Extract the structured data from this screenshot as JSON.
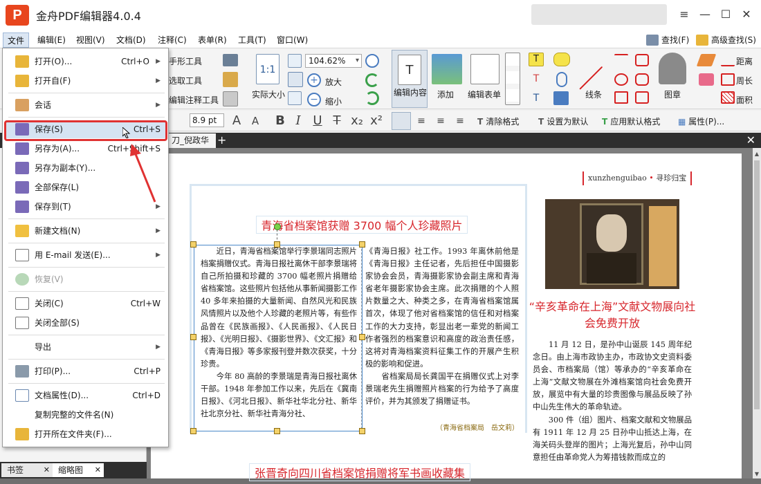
{
  "app": {
    "title": "金舟PDF编辑器4.0.4",
    "logo_letter": "P",
    "accent": "#e8461e"
  },
  "window_controls": {
    "menu": "≡",
    "minimize": "—",
    "maximize": "☐",
    "close": "✕"
  },
  "menubar": {
    "items": [
      "文件",
      "编辑(E)",
      "视图(V)",
      "文档(D)",
      "注释(C)",
      "表单(R)",
      "工具(T)",
      "窗口(W)"
    ],
    "find": "查找(F)",
    "advanced_find": "高级查找(S)"
  },
  "ribbon": {
    "tools": [
      "手形工具",
      "选取工具",
      "编辑注释工具"
    ],
    "actual_size": "实际大小",
    "zoom": "104.62%",
    "zoom_in": "放大",
    "zoom_out": "缩小",
    "edit_content": "编辑内容",
    "add": "添加",
    "edit_form": "编辑表单",
    "line": "线条",
    "stamp": "图章",
    "distance": "距离",
    "perimeter": "周长",
    "area": "面积"
  },
  "formatbar": {
    "font_size": "8.9 pt",
    "clear_format": "清除格式",
    "set_default": "设置为默认",
    "apply_default": "应用默认格式",
    "properties": "属性(P)..."
  },
  "tabs": {
    "doc_tab": "刀_倪政华",
    "plus": "+",
    "close": "✕"
  },
  "left_panel": {
    "tabs": [
      "书签",
      "缩略图"
    ]
  },
  "file_menu": {
    "items": [
      {
        "label": "打开(O)...",
        "shortcut": "Ctrl+O",
        "submenu": true
      },
      {
        "label": "打开自(F)",
        "shortcut": "",
        "submenu": true
      },
      {
        "label": "会话",
        "shortcut": "",
        "submenu": true
      },
      {
        "label": "保存(S)",
        "shortcut": "Ctrl+S",
        "submenu": false,
        "highlighted": true
      },
      {
        "label": "另存为(A)...",
        "shortcut": "Ctrl+Shift+S",
        "submenu": false
      },
      {
        "label": "另存为副本(Y)...",
        "shortcut": "",
        "submenu": false
      },
      {
        "label": "全部保存(L)",
        "shortcut": "",
        "submenu": false
      },
      {
        "label": "保存到(T)",
        "shortcut": "",
        "submenu": true
      },
      {
        "label": "新建文档(N)",
        "shortcut": "",
        "submenu": true
      },
      {
        "label": "用 E-mail 发送(E)...",
        "shortcut": "",
        "submenu": true
      },
      {
        "label": "恢复(V)",
        "shortcut": "",
        "submenu": false,
        "disabled": true
      },
      {
        "label": "关闭(C)",
        "shortcut": "Ctrl+W",
        "submenu": false
      },
      {
        "label": "关闭全部(S)",
        "shortcut": "",
        "submenu": false
      },
      {
        "label": "导出",
        "shortcut": "",
        "submenu": true
      },
      {
        "label": "打印(P)...",
        "shortcut": "Ctrl+P",
        "submenu": false
      },
      {
        "label": "文档属性(D)...",
        "shortcut": "Ctrl+D",
        "submenu": false
      },
      {
        "label": "复制完整的文件名(N)",
        "shortcut": "",
        "submenu": false
      },
      {
        "label": "打开所在文件夹(F)...",
        "shortcut": "",
        "submenu": false
      }
    ]
  },
  "document": {
    "tag_text": "xunzhenguibao",
    "tag_dot": "•",
    "tag_cn": "寻珍归宝",
    "headline1": "青海省档案馆获赠 3700 幅个人珍藏照片",
    "col1": "　　近日，青海省档案馆举行李景瑞同志照片档案捐赠仪式。青海日报社离休干部李景瑞将自己所拍摄和珍藏的 3700 幅老照片捐赠给省档案馆。这些照片包括他从事新闻摄影工作 40 多年来拍摄的大量新闻、自然风光和民族风情照片以及他个人珍藏的老照片等，有些作品曾在《民族画报》、《人民画报》、《人民日报》、《光明日报》、《摄影世界》、《文汇报》和《青海日报》等多家报刊登并数次获奖，十分珍贵。\n　　今年 80 高龄的李景瑞是青海日报社离休干部。1948 年参加工作以来，先后在《冀南日报》、《河北日报》、新华社华北分社、新华社北京分社、新华社青海分社、",
    "col2": "《青海日报》社工作。1993 年离休前他是《青海日报》主任记者，先后担任中国摄影家协会会员，青海摄影家协会副主席和青海省老年摄影家协会主席。此次捐赠的个人照片数量之大、种类之多，在青海省档案馆属首次，体现了他对省档案馆的信任和对档案工作的大力支持，彰显出老一辈党的新闻工作者强烈的档案意识和高度的政治责任感，这将对青海档案资料征集工作的开展产生积极的影响和促进。\n　　省档案局局长龚国平在捐赠仪式上对李景瑞老先生捐赠照片档案的行为给予了高度评价，并为其颁发了捐赠证书。",
    "col2_sign": "（青海省档案局　岳文莉）",
    "headline2": "“辛亥革命在上海”文献文物展向社会免费开放",
    "col3": "　　11 月 12 日，是孙中山诞辰 145 周年纪念日。由上海市政协主办，市政协文史资料委员会、市档案局（馆）等承办的“辛亥革命在上海”文献文物展在外滩档案馆向社会免费开放，展览中有大量的珍贵图像与展品反映了孙中山先生伟大的革命轨迹。\n　　300 件（组）图片、档案文献和文物展品有 1911 年 12 月 25 日孙中山抵达上海，在海关码头登岸的图片；上海光复后，孙中山同意担任由革命党人为筹措钱款而成立的",
    "headline3": "张晋奇向四川省档案馆捐赠将军书画收藏集"
  }
}
